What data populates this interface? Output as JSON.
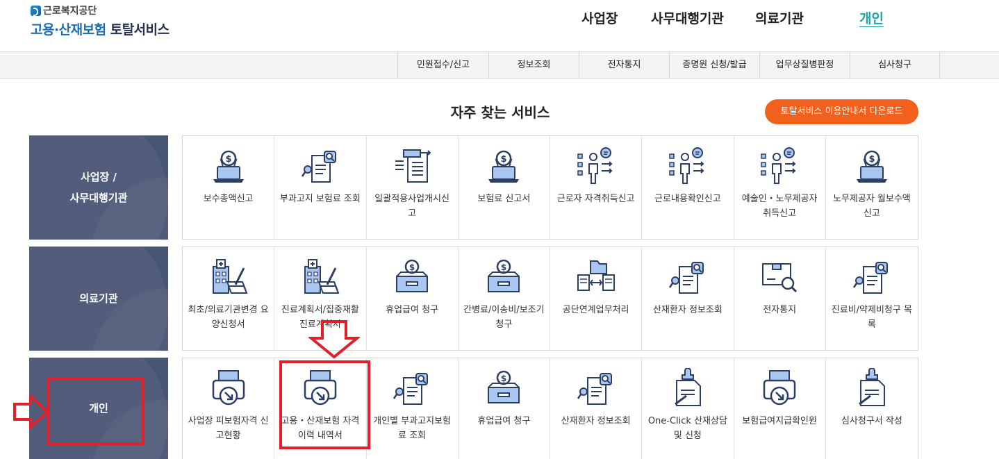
{
  "header": {
    "org_name": "근로복지공단",
    "title_blue": "고용·산재보험",
    "title_dark": " 토탈서비스",
    "gnb": [
      "사업장",
      "사무대행기관",
      "의료기관",
      "개인"
    ]
  },
  "subnav": [
    "민원접수/신고",
    "정보조회",
    "전자통지",
    "증명원 신청/발급",
    "업무상질병판정",
    "심사청구"
  ],
  "section_title": "자주 찾는 서비스",
  "download_button": "토탈서비스 이용안내서 다운로드",
  "rows": [
    {
      "category": "사업장 /\n사무대행기관",
      "items": [
        {
          "label": "보수총액신고",
          "icon": "money-laptop-icon"
        },
        {
          "label": "부과고지 보험료 조회",
          "icon": "document-search-icon"
        },
        {
          "label": "일괄적용사업개시신고",
          "icon": "document-list-icon"
        },
        {
          "label": "보험료 신고서",
          "icon": "money-laptop-icon"
        },
        {
          "label": "근로자 자격취득신고",
          "icon": "person-checklist-icon"
        },
        {
          "label": "근로내용확인신고",
          "icon": "person-checklist-icon"
        },
        {
          "label": "예술인・노무제공자 취득신고",
          "icon": "person-checklist-icon"
        },
        {
          "label": "노무제공자 월보수액 신고",
          "icon": "money-laptop-icon"
        }
      ]
    },
    {
      "category": "의료기관",
      "items": [
        {
          "label": "최초/의료기관변경 요양신청서",
          "icon": "hospital-document-icon"
        },
        {
          "label": "진료계획서/집중재활진료계획서",
          "icon": "hospital-document-icon"
        },
        {
          "label": "휴업급여 청구",
          "icon": "money-box-icon"
        },
        {
          "label": "간병료/이송비/보조기 청구",
          "icon": "money-box-icon"
        },
        {
          "label": "공단연계업무처리",
          "icon": "file-exchange-icon"
        },
        {
          "label": "산재환자 정보조회",
          "icon": "document-search-icon"
        },
        {
          "label": "전자통지",
          "icon": "notice-search-icon"
        },
        {
          "label": "진료비/약제비청구 목록",
          "icon": "document-search-icon"
        }
      ]
    },
    {
      "category": "개인",
      "items": [
        {
          "label": "사업장 피보험자격 신고현황",
          "icon": "printer-download-icon"
        },
        {
          "label": "고용・산재보험 자격 이력 내역서",
          "icon": "printer-download-icon"
        },
        {
          "label": "개인별 부과고지보험료 조회",
          "icon": "document-search-icon"
        },
        {
          "label": "휴업급여 청구",
          "icon": "money-box-icon"
        },
        {
          "label": "산재환자 정보조회",
          "icon": "document-search-icon"
        },
        {
          "label": "One-Click 산재상담 및 신청",
          "icon": "document-pen-icon"
        },
        {
          "label": "보험급여지급확인원",
          "icon": "printer-download-icon"
        },
        {
          "label": "심사청구서 작성",
          "icon": "document-pen-icon"
        }
      ]
    }
  ],
  "colors": {
    "category_bg": "#485573",
    "accent_teal": "#1fa3a8",
    "download_orange": "#f1601d",
    "annotation_red": "#e0202a",
    "icon_navy": "#2d3e63",
    "icon_blue": "#a9c7f0"
  }
}
